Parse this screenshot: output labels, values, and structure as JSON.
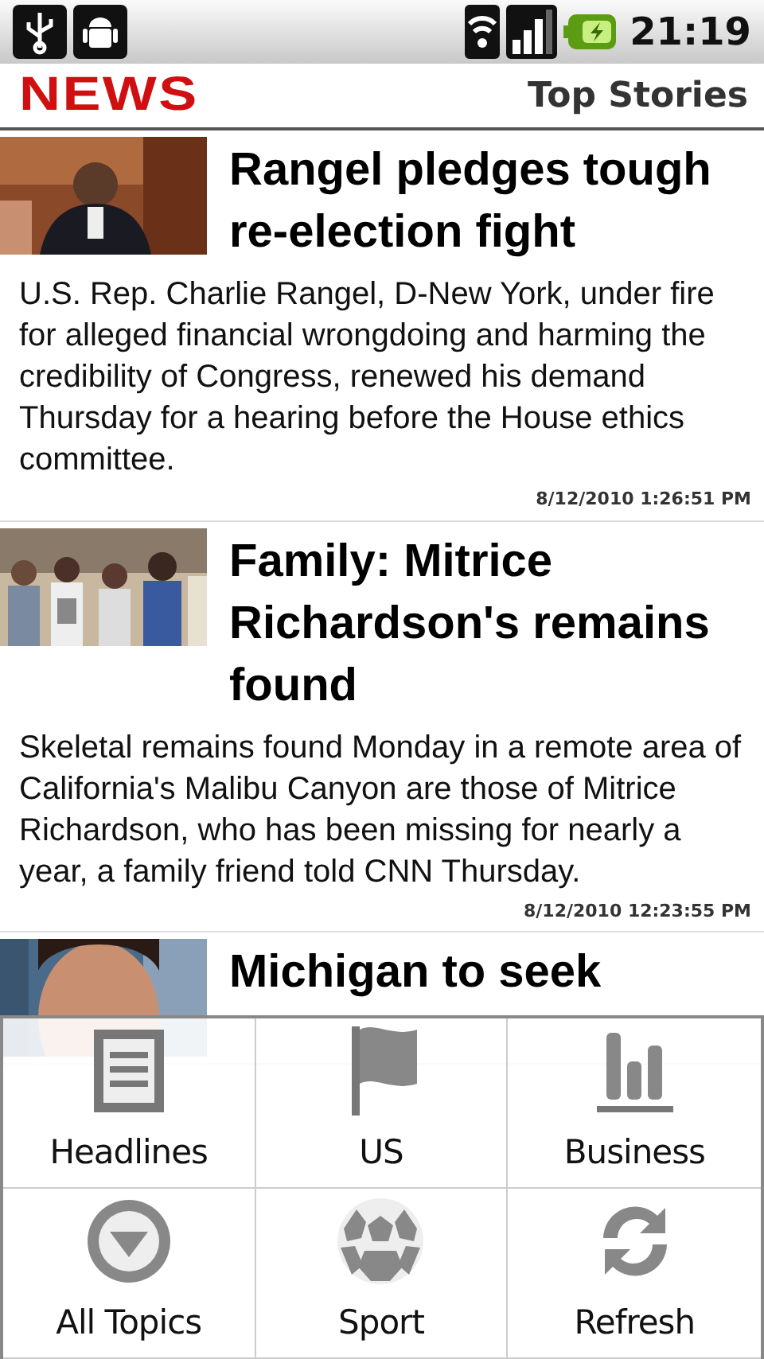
{
  "status_bar": {
    "time": "21:19"
  },
  "header": {
    "logo": "NEWS",
    "title": "Top Stories"
  },
  "stories": [
    {
      "headline": "Rangel pledges tough re-election fight",
      "summary": "U.S. Rep. Charlie Rangel, D-New York, under fire for alleged financial wrongdoing and harming the credibility of Congress, renewed his demand Thursday for a hearing before the House ethics committee.",
      "timestamp": "8/12/2010 1:26:51 PM"
    },
    {
      "headline": "Family: Mitrice Richardson's remains found",
      "summary": "Skeletal remains found Monday in a remote area of California's Malibu Canyon are those of Mitrice Richardson, who has been missing for nearly a year, a family friend told CNN Thursday.",
      "timestamp": "8/12/2010 12:23:55 PM"
    },
    {
      "headline": "Michigan to seek"
    }
  ],
  "menu": [
    {
      "label": "Headlines"
    },
    {
      "label": "US"
    },
    {
      "label": "Business"
    },
    {
      "label": "All Topics"
    },
    {
      "label": "Sport"
    },
    {
      "label": "Refresh"
    }
  ]
}
